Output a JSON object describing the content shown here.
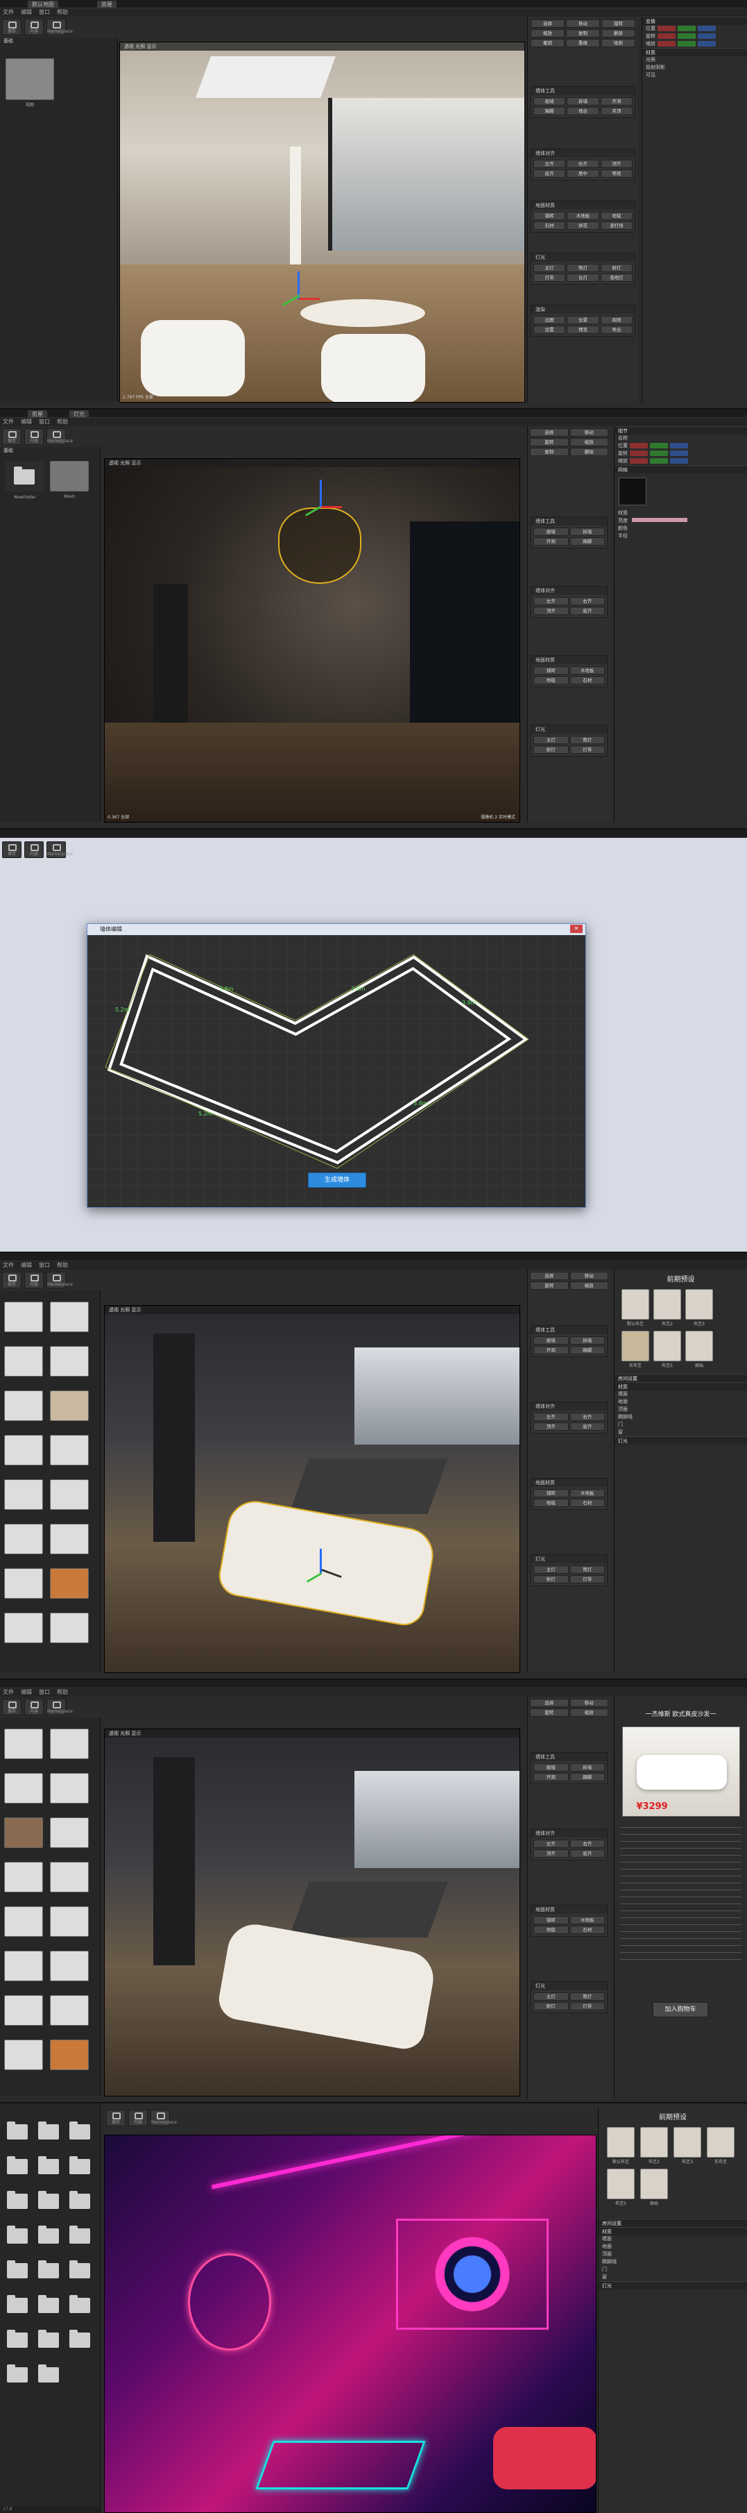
{
  "menu": [
    "文件",
    "编辑",
    "窗口",
    "帮助"
  ],
  "toolbar": [
    "保存",
    "内容",
    "Marketplace"
  ],
  "p1": {
    "tabs": [
      "默认地图",
      "房屋"
    ],
    "left_header": "基础",
    "left_item": "视图",
    "vpbar": "透视 光照 显示",
    "stat": "1.797 FPS 全部",
    "vpfoot": "摄像机 0.5"
  },
  "p2": {
    "tabs": [
      "房屋",
      "灯光"
    ],
    "left_header": "基础",
    "items": [
      "NewFolder",
      "Mesh"
    ],
    "stat": "0.367 全部",
    "vpfoot": "摄像机 2 实时模式"
  },
  "p3": {
    "dialog_title": "墙体编辑",
    "generate_btn": "生成墙体",
    "labels": [
      "3.8m",
      "3.8m",
      "3.8m",
      "3.8m",
      "5.2m",
      "5.2m",
      "2.6m",
      "2.6m"
    ]
  },
  "p4": {
    "right_title": "前期预设",
    "swatches": [
      "默认布艺",
      "布艺2",
      "布艺3",
      "灰布艺",
      "布艺5",
      "原始"
    ],
    "section1": "房间设置",
    "section2": "材质",
    "rows": [
      "墙面",
      "地面",
      "顶面",
      "踢脚线",
      "门",
      "窗"
    ],
    "section3": "灯光"
  },
  "p5": {
    "right_header": "一杰维斯 欧式真皮沙发一",
    "price": "¥3299",
    "btn": "加入购物车"
  },
  "p6": {
    "right_title": "前期预设",
    "stat": "17.8"
  },
  "tools": {
    "top": [
      "选择",
      "移动",
      "旋转",
      "缩放",
      "复制",
      "删除",
      "撤销",
      "重做",
      "吸附"
    ],
    "g1": {
      "head": "墙体工具",
      "items": [
        "画墙",
        "拆墙",
        "开洞",
        "踢脚",
        "地台",
        "吊顶",
        "门洞",
        "窗洞",
        "楼梯"
      ]
    },
    "g2": {
      "head": "墙体对齐",
      "items": [
        "左齐",
        "右齐",
        "顶齐",
        "底齐",
        "居中",
        "等距"
      ]
    },
    "g3": {
      "head": "地面材质",
      "items": [
        "铺砖",
        "木地板",
        "地毯",
        "石材",
        "拼花",
        "波打线"
      ]
    },
    "g4": {
      "head": "灯光",
      "items": [
        "主灯",
        "筒灯",
        "射灯",
        "灯带",
        "台灯",
        "落地灯"
      ]
    },
    "g5": {
      "head": "渲染",
      "items": [
        "出图",
        "全景",
        "视频",
        "设置",
        "预览",
        "导出"
      ]
    }
  },
  "props": {
    "p1": [
      "变换",
      "位置",
      "旋转",
      "缩放",
      "材质",
      "光照",
      "投射阴影",
      "可见"
    ],
    "p2": [
      "细节",
      "名称",
      "位置",
      "旋转",
      "缩放",
      "网格",
      "材质",
      "亮度",
      "颜色",
      "半径"
    ]
  }
}
